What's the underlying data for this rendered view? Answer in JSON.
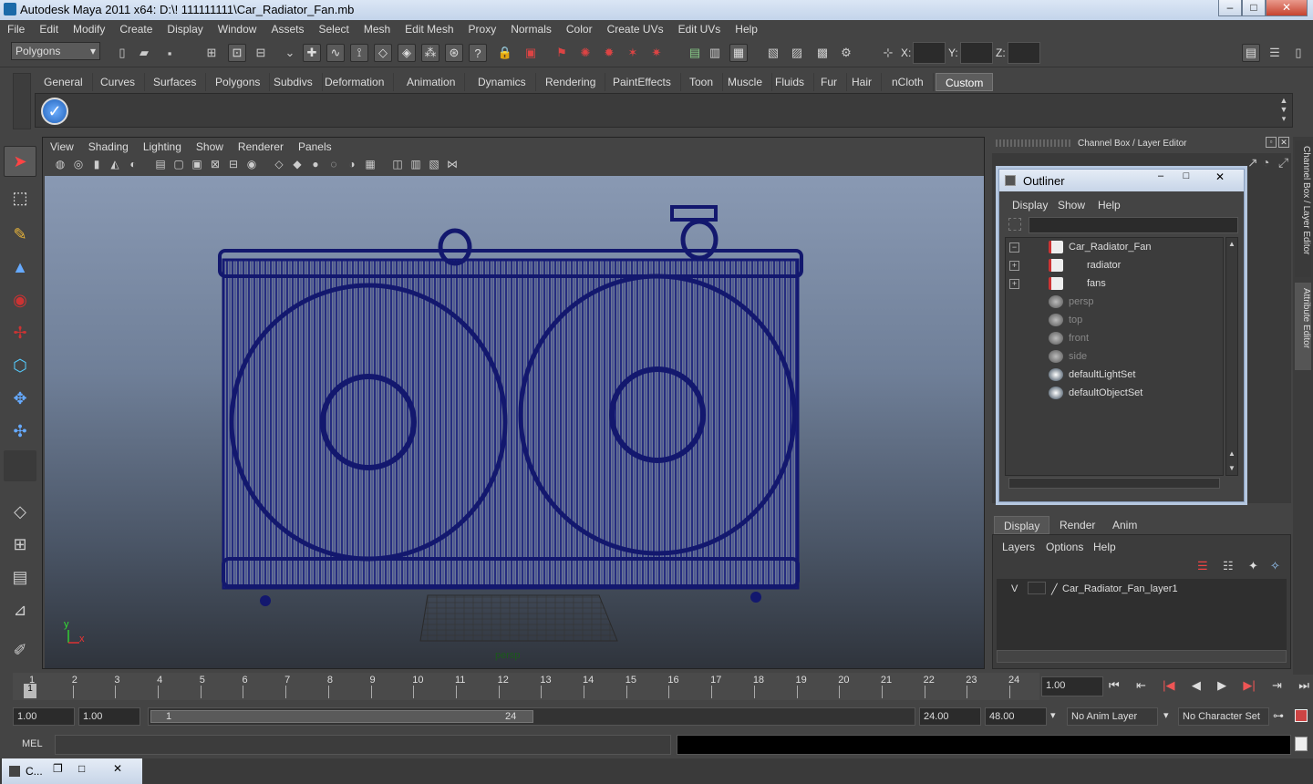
{
  "window": {
    "title": "Autodesk Maya 2011 x64: D:\\! 111111111\\Car_Radiator_Fan.mb"
  },
  "menu": [
    "File",
    "Edit",
    "Modify",
    "Create",
    "Display",
    "Window",
    "Assets",
    "Select",
    "Mesh",
    "Edit Mesh",
    "Proxy",
    "Normals",
    "Color",
    "Create UVs",
    "Edit UVs",
    "Help"
  ],
  "status": {
    "mode": "Polygons",
    "x_label": "X:",
    "y_label": "Y:",
    "z_label": "Z:"
  },
  "shelf_tabs": [
    "General",
    "Curves",
    "Surfaces",
    "Polygons",
    "Subdivs",
    "Deformation",
    "Animation",
    "Dynamics",
    "Rendering",
    "PaintEffects",
    "Toon",
    "Muscle",
    "Fluids",
    "Fur",
    "Hair",
    "nCloth",
    "Custom"
  ],
  "active_shelf": "Custom",
  "viewport": {
    "menu": [
      "View",
      "Shading",
      "Lighting",
      "Show",
      "Renderer",
      "Panels"
    ],
    "camera_label": "persp",
    "axis_y": "y",
    "axis_x": "x"
  },
  "channel_box": {
    "title": "Channel Box / Layer Editor",
    "side_tab_1": "Channel Box / Layer Editor",
    "side_tab_2": "Attribute Editor"
  },
  "outliner": {
    "title": "Outliner",
    "menu": [
      "Display",
      "Show",
      "Help"
    ],
    "items": [
      {
        "name": "Car_Radiator_Fan",
        "expand": "−",
        "dim": false
      },
      {
        "name": "radiator",
        "expand": "+",
        "dim": false
      },
      {
        "name": "fans",
        "expand": "+",
        "dim": false
      },
      {
        "name": "persp",
        "expand": "",
        "dim": true
      },
      {
        "name": "top",
        "expand": "",
        "dim": true
      },
      {
        "name": "front",
        "expand": "",
        "dim": true
      },
      {
        "name": "side",
        "expand": "",
        "dim": true
      },
      {
        "name": "defaultLightSet",
        "expand": "",
        "dim": false
      },
      {
        "name": "defaultObjectSet",
        "expand": "",
        "dim": false
      }
    ]
  },
  "layer_editor": {
    "tabs": [
      "Display",
      "Render",
      "Anim"
    ],
    "menu": [
      "Layers",
      "Options",
      "Help"
    ],
    "layer_visible": "V",
    "layer_name": "Car_Radiator_Fan_layer1"
  },
  "timeline": {
    "ticks": [
      "1",
      "2",
      "3",
      "4",
      "5",
      "6",
      "7",
      "8",
      "9",
      "10",
      "11",
      "12",
      "13",
      "14",
      "15",
      "16",
      "17",
      "18",
      "19",
      "20",
      "21",
      "22",
      "23",
      "24"
    ],
    "current_frame_marker": "1",
    "current_time": "1.00"
  },
  "range": {
    "start_time": "1.00",
    "playback_start": "1.00",
    "range_start_label": "1",
    "range_end_label": "24",
    "playback_end": "24.00",
    "end_time": "48.00",
    "anim_layer": "No Anim Layer",
    "character_set": "No Character Set"
  },
  "command_line": {
    "label": "MEL"
  },
  "taskbar": {
    "item": "C..."
  }
}
